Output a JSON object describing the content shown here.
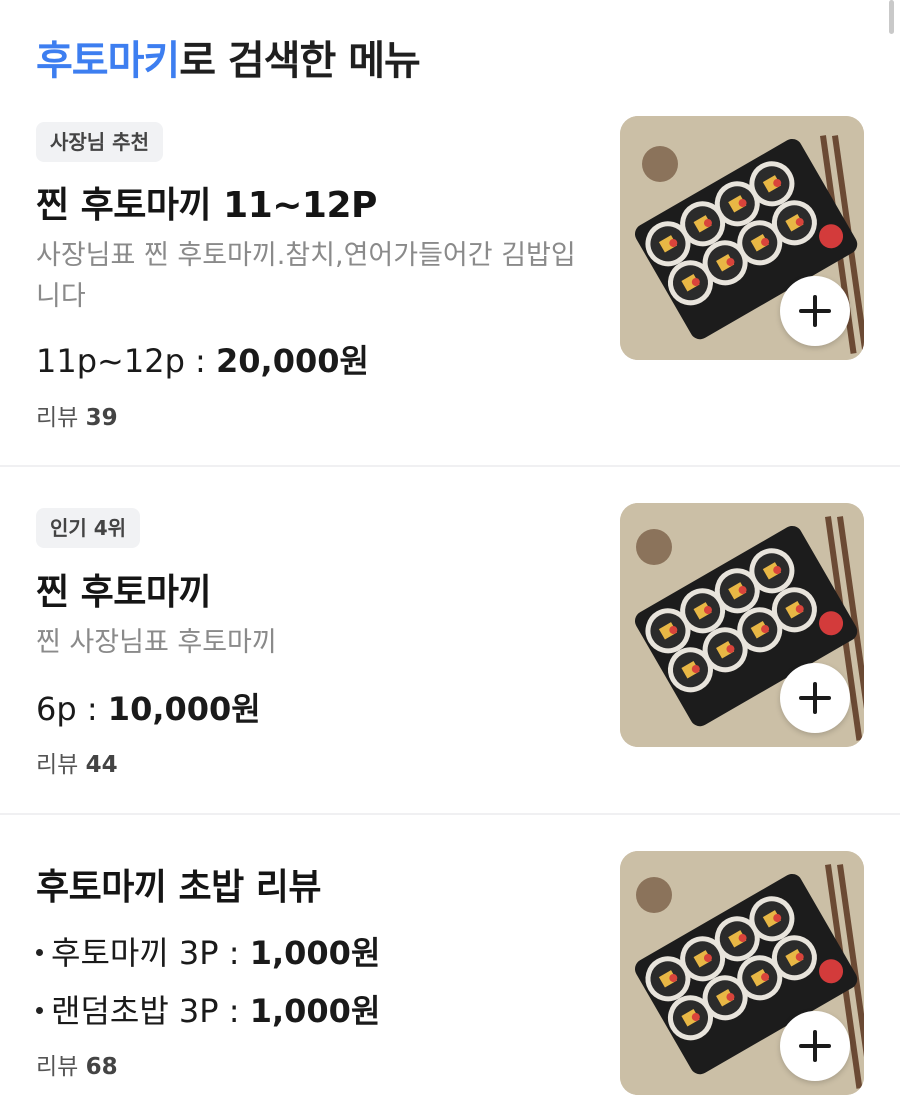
{
  "header": {
    "keyword": "후토마키",
    "suffix": "로 검색한 메뉴"
  },
  "items": [
    {
      "badge": "사장님 추천",
      "title": "찐 후토마끼 11~12P",
      "description": "사장님표 찐 후토마끼.참치,연어가들어간 김밥입니다",
      "price_label": "11p~12p : ",
      "price_value": "20,000원",
      "review_label": "리뷰",
      "review_count": "39",
      "image_icon": "futomaki-photo",
      "add_icon": "plus-icon"
    },
    {
      "badge": "인기 4위",
      "title": "찐 후토마끼",
      "description": "찐 사장님표 후토마끼",
      "price_label": "6p : ",
      "price_value": "10,000원",
      "review_label": "리뷰",
      "review_count": "44",
      "image_icon": "futomaki-photo",
      "add_icon": "plus-icon"
    },
    {
      "title": "후토마끼 초밥 리뷰",
      "options": [
        {
          "label": "후토마끼 3P : ",
          "value": "1,000원"
        },
        {
          "label": "랜덤초밥 3P : ",
          "value": "1,000원"
        }
      ],
      "review_label": "리뷰",
      "review_count": "68",
      "image_icon": "futomaki-photo",
      "add_icon": "plus-icon"
    }
  ]
}
